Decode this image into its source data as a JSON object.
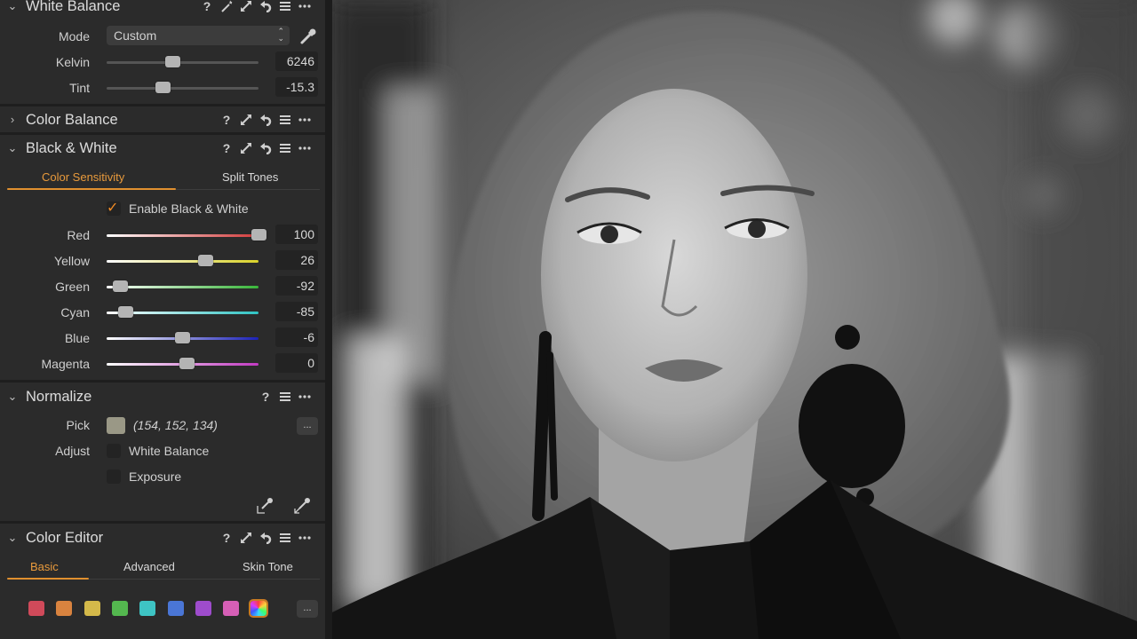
{
  "panel": {
    "white_balance": {
      "title": "White Balance",
      "expanded": true,
      "header_icons": [
        "help-icon",
        "magic-wand-icon",
        "expand-icon",
        "reset-icon",
        "menu-icon",
        "more-icon"
      ],
      "mode_label": "Mode",
      "mode_value": "Custom",
      "kelvin_label": "Kelvin",
      "kelvin_value": "6246",
      "kelvin_fraction": 0.43,
      "tint_label": "Tint",
      "tint_value": "-15.3",
      "tint_fraction": 0.37
    },
    "color_balance": {
      "title": "Color Balance",
      "expanded": false,
      "header_icons": [
        "help-icon",
        "expand-icon",
        "reset-icon",
        "menu-icon",
        "more-icon"
      ]
    },
    "black_white": {
      "title": "Black & White",
      "expanded": true,
      "header_icons": [
        "help-icon",
        "expand-icon",
        "reset-icon",
        "menu-icon",
        "more-icon"
      ],
      "tabs": [
        {
          "label": "Color Sensitivity",
          "active": true
        },
        {
          "label": "Split Tones",
          "active": false
        }
      ],
      "enable_label": "Enable Black & White",
      "enable_checked": true,
      "sliders": [
        {
          "label": "Red",
          "value": "100",
          "num": 100,
          "color": "#d23a3a"
        },
        {
          "label": "Yellow",
          "value": "26",
          "num": 26,
          "color": "#d9d22a"
        },
        {
          "label": "Green",
          "value": "-92",
          "num": -92,
          "color": "#39b63a"
        },
        {
          "label": "Cyan",
          "value": "-85",
          "num": -85,
          "color": "#2fc3c3"
        },
        {
          "label": "Blue",
          "value": "-6",
          "num": -6,
          "color": "#1c22b8"
        },
        {
          "label": "Magenta",
          "value": "0",
          "num": 0,
          "color": "#c23ac2"
        }
      ]
    },
    "normalize": {
      "title": "Normalize",
      "expanded": true,
      "header_icons": [
        "help-icon",
        "menu-icon",
        "more-icon"
      ],
      "pick_label": "Pick",
      "pick_swatch_color": "#9a9886",
      "pick_value": "(154, 152, 134)",
      "pick_more": "...",
      "adjust_label": "Adjust",
      "adjust_options": [
        {
          "label": "White Balance",
          "checked": false
        },
        {
          "label": "Exposure",
          "checked": false
        }
      ]
    },
    "color_editor": {
      "title": "Color Editor",
      "expanded": true,
      "header_icons": [
        "help-icon",
        "expand-icon",
        "reset-icon",
        "menu-icon",
        "more-icon"
      ],
      "tabs": [
        {
          "label": "Basic",
          "active": true
        },
        {
          "label": "Advanced",
          "active": false
        },
        {
          "label": "Skin Tone",
          "active": false
        }
      ],
      "colors": [
        {
          "name": "red",
          "color": "#d04a5a"
        },
        {
          "name": "orange",
          "color": "#d9833f"
        },
        {
          "name": "yellow",
          "color": "#d4b94a"
        },
        {
          "name": "green",
          "color": "#54b84f"
        },
        {
          "name": "cyan",
          "color": "#3ec4c4"
        },
        {
          "name": "blue",
          "color": "#4a76d6"
        },
        {
          "name": "purple",
          "color": "#9e4ccc"
        },
        {
          "name": "magenta",
          "color": "#d65fb6"
        },
        {
          "name": "all-colors",
          "color": "rainbow",
          "selected": true
        }
      ],
      "more": "..."
    }
  },
  "accent_color": "#e89a3c",
  "viewer": {
    "description": "Black and white portrait of a woman with wavy hair and black earrings"
  }
}
